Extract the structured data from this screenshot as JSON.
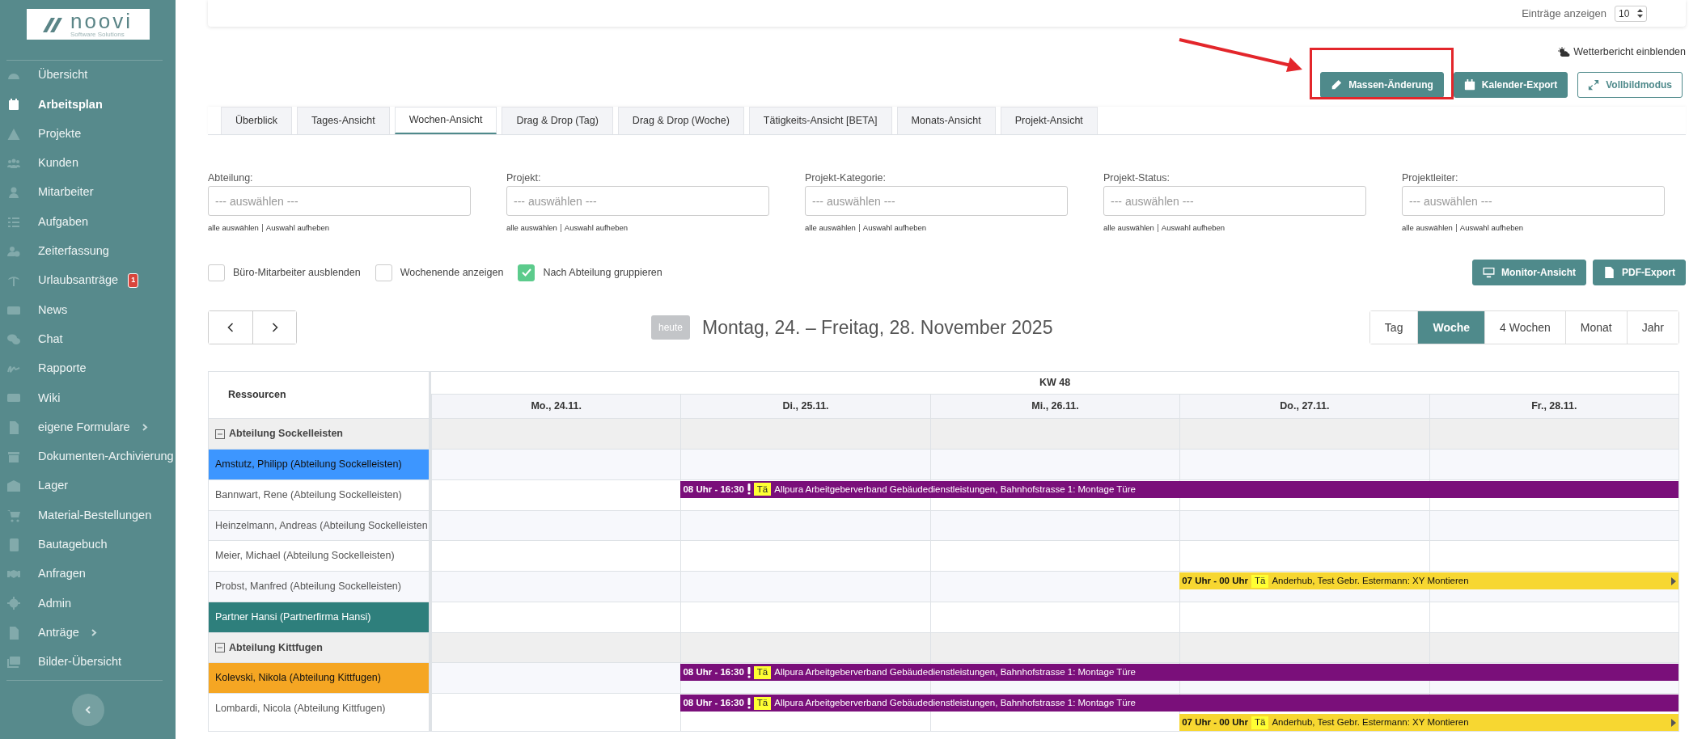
{
  "sidebar": {
    "logo": {
      "text": "noovi",
      "tagline": "Software Solutions"
    },
    "items": [
      {
        "label": "Übersicht",
        "selected": false
      },
      {
        "label": "Arbeitsplan",
        "selected": true
      },
      {
        "label": "Projekte",
        "selected": false
      },
      {
        "label": "Kunden",
        "selected": false
      },
      {
        "label": "Mitarbeiter",
        "selected": false
      },
      {
        "label": "Aufgaben",
        "selected": false
      },
      {
        "label": "Zeiterfassung",
        "selected": false
      },
      {
        "label": "Urlaubsanträge",
        "selected": false,
        "badge": "1"
      },
      {
        "label": "News",
        "selected": false
      },
      {
        "label": "Chat",
        "selected": false
      },
      {
        "label": "Rapporte",
        "selected": false
      },
      {
        "label": "Wiki",
        "selected": false
      },
      {
        "label": "eigene Formulare",
        "selected": false,
        "has_submenu": true
      },
      {
        "label": "Dokumenten-Archivierung",
        "selected": false
      },
      {
        "label": "Lager",
        "selected": false
      },
      {
        "label": "Material-Bestellungen",
        "selected": false
      },
      {
        "label": "Bautagebuch",
        "selected": false
      },
      {
        "label": "Anfragen",
        "selected": false
      },
      {
        "label": "Admin",
        "selected": false
      },
      {
        "label": "Anträge",
        "selected": false,
        "has_submenu": true
      },
      {
        "label": "Bilder-Übersicht",
        "selected": false
      }
    ]
  },
  "top_card": {
    "entries_label": "Einträge anzeigen",
    "entries_value": "10"
  },
  "weather_toggle": {
    "label": "Wetterbericht einblenden"
  },
  "actions": [
    {
      "label": "Massen-Änderung",
      "kind": "edit",
      "outline": false,
      "highlighted": true
    },
    {
      "label": "Kalender-Export",
      "kind": "calendar",
      "outline": false,
      "highlighted": false
    },
    {
      "label": "Vollbildmodus",
      "kind": "fullscreen",
      "outline": true,
      "highlighted": false
    }
  ],
  "tabs": [
    {
      "label": "Überblick",
      "selected": false
    },
    {
      "label": "Tages-Ansicht",
      "selected": false
    },
    {
      "label": "Wochen-Ansicht",
      "selected": true
    },
    {
      "label": "Drag & Drop (Tag)",
      "selected": false
    },
    {
      "label": "Drag & Drop (Woche)",
      "selected": false
    },
    {
      "label": "Tätigkeits-Ansicht [BETA]",
      "selected": false
    },
    {
      "label": "Monats-Ansicht",
      "selected": false
    },
    {
      "label": "Projekt-Ansicht",
      "selected": false
    }
  ],
  "filters": [
    {
      "label": "Abteilung:",
      "placeholder": "--- auswählen ---",
      "select_all": "alle auswählen",
      "clear": "Auswahl aufheben"
    },
    {
      "label": "Projekt:",
      "placeholder": "--- auswählen ---",
      "select_all": "alle auswählen",
      "clear": "Auswahl aufheben"
    },
    {
      "label": "Projekt-Kategorie:",
      "placeholder": "--- auswählen ---",
      "select_all": "alle auswählen",
      "clear": "Auswahl aufheben"
    },
    {
      "label": "Projekt-Status:",
      "placeholder": "--- auswählen ---",
      "select_all": "alle auswählen",
      "clear": "Auswahl aufheben"
    },
    {
      "label": "Projektleiter:",
      "placeholder": "--- auswählen ---",
      "select_all": "alle auswählen",
      "clear": "Auswahl aufheben"
    }
  ],
  "options": [
    {
      "label": "Büro-Mitarbeiter ausblenden",
      "checked": false
    },
    {
      "label": "Wochenende anzeigen",
      "checked": false
    },
    {
      "label": "Nach Abteilung gruppieren",
      "checked": true
    }
  ],
  "export_buttons": [
    {
      "label": "Monitor-Ansicht",
      "kind": "monitor"
    },
    {
      "label": "PDF-Export",
      "kind": "pdf"
    }
  ],
  "navigation": {
    "today": "heute",
    "range": "Montag, 24. – Freitag, 28. November 2025",
    "views": [
      {
        "label": "Tag",
        "selected": false
      },
      {
        "label": "Woche",
        "selected": true
      },
      {
        "label": "4 Wochen",
        "selected": false
      },
      {
        "label": "Monat",
        "selected": false
      },
      {
        "label": "Jahr",
        "selected": false
      }
    ]
  },
  "calendar": {
    "resources_header": "Ressourcen",
    "week": "KW 48",
    "days": [
      "Mo., 24.11.",
      "Di., 25.11.",
      "Mi., 26.11.",
      "Do., 27.11.",
      "Fr., 28.11."
    ],
    "rows": [
      {
        "kind": "group",
        "label": "Abteilung Sockelleisten",
        "expanded": true
      },
      {
        "kind": "resource",
        "label": "Amstutz, Philipp (Abteilung Sockelleisten)",
        "color": "#3d96ff"
      },
      {
        "kind": "resource",
        "label": "Bannwart, Rene (Abteilung Sockelleisten)",
        "events": [
          {
            "time": "08 Uhr - 16:30",
            "urgent": true,
            "tag": "Tä",
            "title": "Allpura Arbeitgeberverband Gebäudedienstleistungen, Bahnhofstrasse 1: Montage Türe",
            "color": "#7a0f7a",
            "days": [
              false,
              true,
              true,
              true,
              true
            ],
            "continues": false
          }
        ]
      },
      {
        "kind": "resource",
        "label": "Heinzelmann, Andreas (Abteilung Sockelleisten"
      },
      {
        "kind": "resource",
        "label": "Meier, Michael (Abteilung Sockelleisten)"
      },
      {
        "kind": "resource",
        "label": "Probst, Manfred (Abteilung Sockelleisten)",
        "events": [
          {
            "time": "07 Uhr - 00 Uhr",
            "urgent": false,
            "tag": "Tä",
            "title": "Anderhub, Test Gebr. Estermann: XY Montieren",
            "color": "#f7d731",
            "days": [
              false,
              false,
              false,
              true,
              true
            ],
            "continues": true
          }
        ]
      },
      {
        "kind": "resource",
        "label": "Partner Hansi (Partnerfirma Hansi)",
        "color": "#2e7f7c"
      },
      {
        "kind": "group",
        "label": "Abteilung Kittfugen",
        "expanded": true
      },
      {
        "kind": "resource",
        "label": "Kolevski, Nikola (Abteilung Kittfugen)",
        "color": "#f5a623",
        "events": [
          {
            "time": "08 Uhr - 16:30",
            "urgent": true,
            "tag": "Tä",
            "title": "Allpura Arbeitgeberverband Gebäudedienstleistungen, Bahnhofstrasse 1: Montage Türe",
            "color": "#7a0f7a",
            "days": [
              false,
              true,
              true,
              true,
              true
            ],
            "continues": false
          }
        ]
      },
      {
        "kind": "resource",
        "label": "Lombardi, Nicola (Abteilung Kittfugen)",
        "events": [
          {
            "time": "08 Uhr - 16:30",
            "urgent": true,
            "tag": "Tä",
            "title": "Allpura Arbeitgeberverband Gebäudedienstleistungen, Bahnhofstrasse 1: Montage Türe",
            "color": "#7a0f7a",
            "days": [
              false,
              true,
              true,
              true,
              true
            ],
            "continues": false
          },
          {
            "time": "07 Uhr - 00 Uhr",
            "urgent": false,
            "tag": "Tä",
            "title": "Anderhub, Test Gebr. Estermann: XY Montieren",
            "color": "#f7d731",
            "days": [
              false,
              false,
              false,
              true,
              true
            ],
            "continues": true
          }
        ]
      }
    ]
  }
}
